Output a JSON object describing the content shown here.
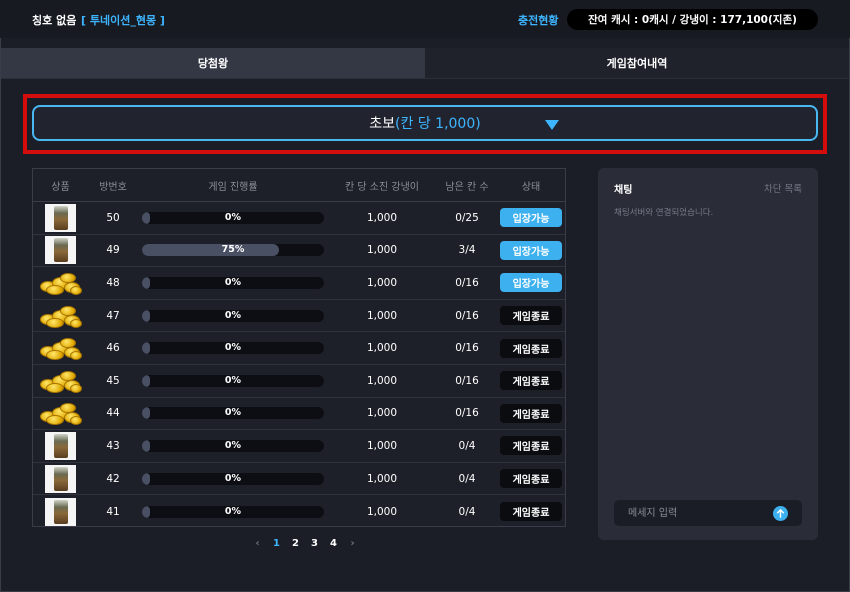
{
  "header": {
    "user_rank": "칭호 없음",
    "user_name": "[ 투네이션_현몽 ]",
    "charge_link": "충전현황",
    "balance": "잔여 캐시 : 0캐시 / 강냉이 : 177,100(지존)"
  },
  "tabs": [
    {
      "label": "당첨왕",
      "active": true
    },
    {
      "label": "게임참여내역",
      "active": false
    }
  ],
  "level_select": {
    "main": "초보",
    "sub": "(칸 당 1,000)"
  },
  "table": {
    "headers": [
      "상품",
      "방번호",
      "게임 진행률",
      "칸 당 소진 강냉이",
      "남은 칸 수",
      "상태"
    ],
    "rows": [
      {
        "product_icon": "drink-can-icon",
        "room": "50",
        "progress": 0,
        "progress_label": "0%",
        "cost": "1,000",
        "remaining": "0/25",
        "status": "입장가능",
        "open": true
      },
      {
        "product_icon": "drink-can-icon",
        "room": "49",
        "progress": 75,
        "progress_label": "75%",
        "cost": "1,000",
        "remaining": "3/4",
        "status": "입장가능",
        "open": true
      },
      {
        "product_icon": "gold-coins-icon",
        "room": "48",
        "progress": 0,
        "progress_label": "0%",
        "cost": "1,000",
        "remaining": "0/16",
        "status": "입장가능",
        "open": true
      },
      {
        "product_icon": "gold-coins-icon",
        "room": "47",
        "progress": 0,
        "progress_label": "0%",
        "cost": "1,000",
        "remaining": "0/16",
        "status": "게임종료",
        "open": false
      },
      {
        "product_icon": "gold-coins-icon",
        "room": "46",
        "progress": 0,
        "progress_label": "0%",
        "cost": "1,000",
        "remaining": "0/16",
        "status": "게임종료",
        "open": false
      },
      {
        "product_icon": "gold-coins-icon",
        "room": "45",
        "progress": 0,
        "progress_label": "0%",
        "cost": "1,000",
        "remaining": "0/16",
        "status": "게임종료",
        "open": false
      },
      {
        "product_icon": "gold-coins-icon",
        "room": "44",
        "progress": 0,
        "progress_label": "0%",
        "cost": "1,000",
        "remaining": "0/16",
        "status": "게임종료",
        "open": false
      },
      {
        "product_icon": "drink-can-icon",
        "room": "43",
        "progress": 0,
        "progress_label": "0%",
        "cost": "1,000",
        "remaining": "0/4",
        "status": "게임종료",
        "open": false
      },
      {
        "product_icon": "drink-can-icon",
        "room": "42",
        "progress": 0,
        "progress_label": "0%",
        "cost": "1,000",
        "remaining": "0/4",
        "status": "게임종료",
        "open": false
      },
      {
        "product_icon": "drink-can-icon",
        "room": "41",
        "progress": 0,
        "progress_label": "0%",
        "cost": "1,000",
        "remaining": "0/4",
        "status": "게임종료",
        "open": false
      }
    ]
  },
  "pagination": {
    "prev": "‹",
    "next": "›",
    "pages": [
      "1",
      "2",
      "3",
      "4"
    ],
    "current": "1"
  },
  "chat": {
    "title": "채팅",
    "block_list": "차단 목록",
    "system_message": "채팅서버와 연결되었습니다.",
    "input_placeholder": "메세지 입력",
    "send_icon": "arrow-up-icon"
  },
  "colors": {
    "accent": "#3db5ff",
    "highlight_border": "#d40c0c",
    "background": "#1b1d27"
  }
}
